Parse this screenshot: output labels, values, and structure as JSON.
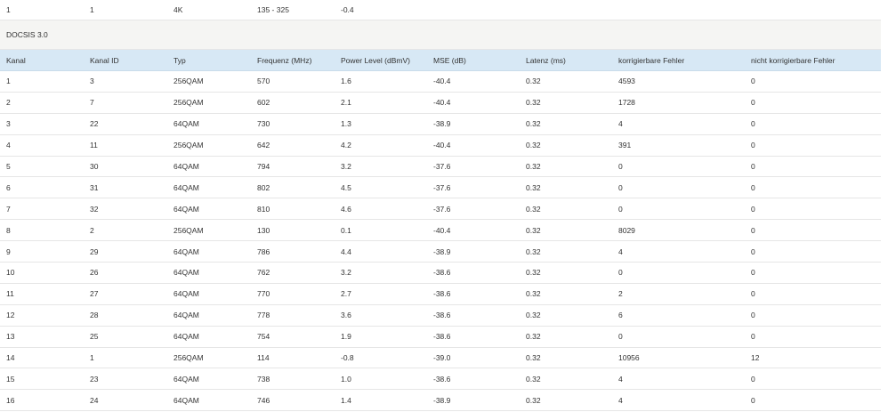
{
  "upstream_row": [
    "1",
    "1",
    "4K",
    "135 - 325",
    "-0.4"
  ],
  "section_title": "DOCSIS 3.0",
  "columns": [
    "Kanal",
    "Kanal ID",
    "Typ",
    "Frequenz (MHz)",
    "Power Level (dBmV)",
    "MSE (dB)",
    "Latenz (ms)",
    "korrigierbare Fehler",
    "nicht korrigierbare Fehler"
  ],
  "rows": [
    [
      "1",
      "3",
      "256QAM",
      "570",
      "1.6",
      "-40.4",
      "0.32",
      "4593",
      "0"
    ],
    [
      "2",
      "7",
      "256QAM",
      "602",
      "2.1",
      "-40.4",
      "0.32",
      "1728",
      "0"
    ],
    [
      "3",
      "22",
      "64QAM",
      "730",
      "1.3",
      "-38.9",
      "0.32",
      "4",
      "0"
    ],
    [
      "4",
      "11",
      "256QAM",
      "642",
      "4.2",
      "-40.4",
      "0.32",
      "391",
      "0"
    ],
    [
      "5",
      "30",
      "64QAM",
      "794",
      "3.2",
      "-37.6",
      "0.32",
      "0",
      "0"
    ],
    [
      "6",
      "31",
      "64QAM",
      "802",
      "4.5",
      "-37.6",
      "0.32",
      "0",
      "0"
    ],
    [
      "7",
      "32",
      "64QAM",
      "810",
      "4.6",
      "-37.6",
      "0.32",
      "0",
      "0"
    ],
    [
      "8",
      "2",
      "256QAM",
      "130",
      "0.1",
      "-40.4",
      "0.32",
      "8029",
      "0"
    ],
    [
      "9",
      "29",
      "64QAM",
      "786",
      "4.4",
      "-38.9",
      "0.32",
      "4",
      "0"
    ],
    [
      "10",
      "26",
      "64QAM",
      "762",
      "3.2",
      "-38.6",
      "0.32",
      "0",
      "0"
    ],
    [
      "11",
      "27",
      "64QAM",
      "770",
      "2.7",
      "-38.6",
      "0.32",
      "2",
      "0"
    ],
    [
      "12",
      "28",
      "64QAM",
      "778",
      "3.6",
      "-38.6",
      "0.32",
      "6",
      "0"
    ],
    [
      "13",
      "25",
      "64QAM",
      "754",
      "1.9",
      "-38.6",
      "0.32",
      "0",
      "0"
    ],
    [
      "14",
      "1",
      "256QAM",
      "114",
      "-0.8",
      "-39.0",
      "0.32",
      "10956",
      "12"
    ],
    [
      "15",
      "23",
      "64QAM",
      "738",
      "1.0",
      "-38.6",
      "0.32",
      "4",
      "0"
    ],
    [
      "16",
      "24",
      "64QAM",
      "746",
      "1.4",
      "-38.9",
      "0.32",
      "4",
      "0"
    ]
  ]
}
